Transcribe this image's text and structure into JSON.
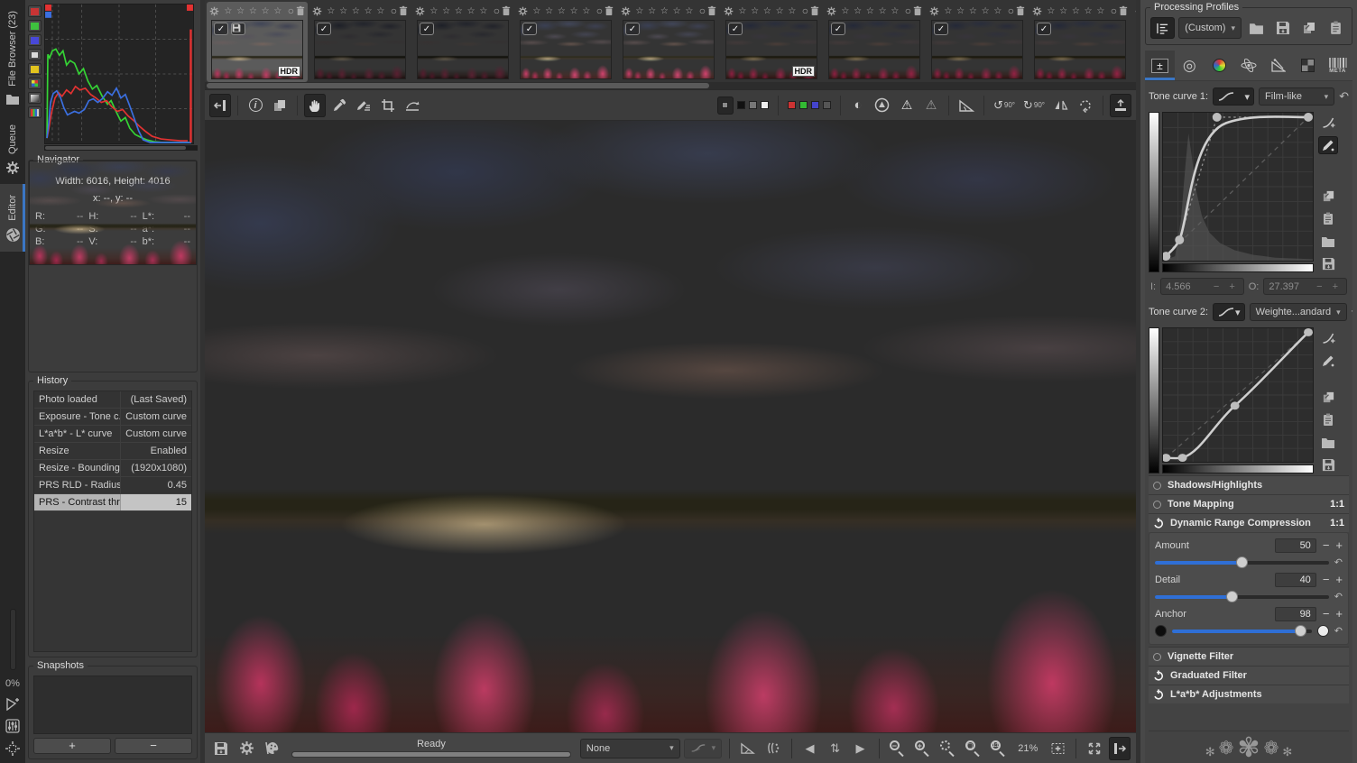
{
  "colors": {
    "accent_blue": "#3a76c4",
    "history_selection": "#b4b4b4",
    "slider_fill": "#2f6fd6"
  },
  "icons": {
    "caret": "▾",
    "check": "✓",
    "star_row": "☆ ☆ ☆ ☆ ☆",
    "circle_label": "○",
    "reset": "↶",
    "rotate_ccw": "↺",
    "rotate_cw": "↻",
    "flip_vertical": "⇅",
    "warning": "⚠",
    "half_circle": "◐",
    "info": "i",
    "prev": "◀",
    "next": "▶",
    "updown": "⇅",
    "zoom_out": "−",
    "zoom_in": "+",
    "one_to_one": "1:1",
    "exposure_tab": "±",
    "detail_tab": "◎",
    "ornament": [
      "✻",
      "❁",
      "✾",
      "❁",
      "✻"
    ]
  },
  "left_rail": {
    "tabs": [
      {
        "label": "File Browser (23)"
      },
      {
        "label": "Queue"
      },
      {
        "label": "Editor"
      }
    ],
    "batch_progress": "0%"
  },
  "navigator": {
    "title": "Navigator",
    "size_line": "Width: 6016, Height: 4016",
    "coords_line": "x: --, y: --",
    "cells": [
      {
        "label": "R:",
        "value": "--"
      },
      {
        "label": "H:",
        "value": "--"
      },
      {
        "label": "L*:",
        "value": "--"
      },
      {
        "label": "G:",
        "value": "--"
      },
      {
        "label": "S:",
        "value": "--"
      },
      {
        "label": "a*:",
        "value": "--"
      },
      {
        "label": "B:",
        "value": "--"
      },
      {
        "label": "V:",
        "value": "--"
      },
      {
        "label": "b*:",
        "value": "--"
      }
    ]
  },
  "history": {
    "title": "History",
    "rows": [
      {
        "name": "Photo loaded",
        "value": "(Last Saved)"
      },
      {
        "name": "Exposure - Tone c...",
        "value": "Custom curve"
      },
      {
        "name": "L*a*b* - L* curve",
        "value": "Custom curve"
      },
      {
        "name": "Resize",
        "value": "Enabled"
      },
      {
        "name": "Resize - Bounding...",
        "value": "(1920x1080)"
      },
      {
        "name": "PRS RLD - Radius",
        "value": "0.45"
      },
      {
        "name": "PRS - Contrast thr...",
        "value": "15",
        "sel": true
      }
    ]
  },
  "snapshots": {
    "title": "Snapshots",
    "add": "+",
    "remove": "−"
  },
  "filmstrip": {
    "hdr_badge": "HDR",
    "thumbs": [
      {
        "sel": true,
        "saved": true,
        "hdr": true,
        "warm": true
      },
      {
        "dark": true
      },
      {
        "dark": true
      },
      {
        "bright": true
      },
      {
        "bright": true
      },
      {
        "hdr": true,
        "dusk": true
      },
      {
        "dusk": true
      },
      {
        "dusk": true
      },
      {
        "dusk": true
      },
      {
        "dark": true
      }
    ]
  },
  "toolbar": {
    "rotate_ccw_label": "90°",
    "rotate_cw_label": "90°"
  },
  "statusbar": {
    "ready": "Ready",
    "preview_profile": "None",
    "zoom_level": "21%"
  },
  "right_panel": {
    "profiles": {
      "title": "Processing Profiles",
      "selected": "(Custom)"
    },
    "meta_tab_label": "META",
    "tone_curve1": {
      "label": "Tone curve 1:",
      "mode": "Film-like"
    },
    "io": {
      "i_label": "I:",
      "i_value": "4.566",
      "o_label": "O:",
      "o_value": "27.397"
    },
    "tone_curve2": {
      "label": "Tone curve 2:",
      "mode": "Weighte...andard"
    },
    "expanders_top": [
      {
        "label": "Shadows/Highlights",
        "badge": ""
      },
      {
        "label": "Tone Mapping",
        "badge": "1:1"
      },
      {
        "label": "Dynamic Range Compression",
        "badge": "1:1",
        "on": true
      }
    ],
    "drc_sliders": [
      {
        "label": "Amount",
        "value": "50",
        "pct": 50
      },
      {
        "label": "Detail",
        "value": "40",
        "pct": 44
      },
      {
        "label": "Anchor",
        "value": "98",
        "pct": 92,
        "bw": true
      }
    ],
    "expanders_bottom": [
      {
        "label": "Vignette Filter"
      },
      {
        "label": "Graduated Filter",
        "on": true
      },
      {
        "label": "L*a*b* Adjustments",
        "on": true
      }
    ]
  }
}
